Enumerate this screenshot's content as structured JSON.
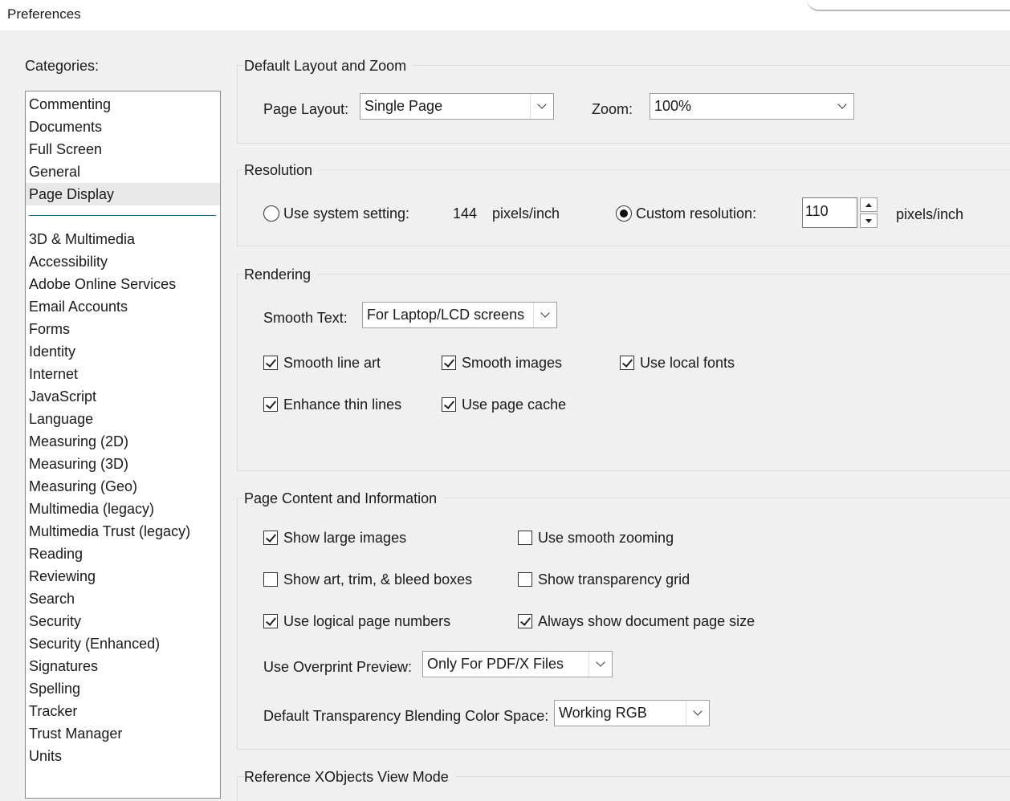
{
  "window": {
    "title": "Preferences"
  },
  "sidebar": {
    "label": "Categories:",
    "top_items": [
      "Commenting",
      "Documents",
      "Full Screen",
      "General",
      "Page Display"
    ],
    "selected": "Page Display",
    "items": [
      "3D & Multimedia",
      "Accessibility",
      "Adobe Online Services",
      "Email Accounts",
      "Forms",
      "Identity",
      "Internet",
      "JavaScript",
      "Language",
      "Measuring (2D)",
      "Measuring (3D)",
      "Measuring (Geo)",
      "Multimedia (legacy)",
      "Multimedia Trust (legacy)",
      "Reading",
      "Reviewing",
      "Search",
      "Security",
      "Security (Enhanced)",
      "Signatures",
      "Spelling",
      "Tracker",
      "Trust Manager",
      "Units"
    ]
  },
  "layout_zoom": {
    "title": "Default Layout and Zoom",
    "page_layout_label": "Page Layout:",
    "page_layout_value": "Single Page",
    "zoom_label": "Zoom:",
    "zoom_value": "100%"
  },
  "resolution": {
    "title": "Resolution",
    "system_label": "Use system setting:",
    "system_value": "144",
    "system_unit": "pixels/inch",
    "custom_label": "Custom resolution:",
    "custom_value": "110",
    "custom_unit": "pixels/inch",
    "selected": "custom"
  },
  "rendering": {
    "title": "Rendering",
    "smooth_text_label": "Smooth Text:",
    "smooth_text_value": "For Laptop/LCD screens",
    "checkboxes": [
      {
        "label": "Smooth line art",
        "checked": true
      },
      {
        "label": "Smooth images",
        "checked": true
      },
      {
        "label": "Use local fonts",
        "checked": true
      },
      {
        "label": "Enhance thin lines",
        "checked": true
      },
      {
        "label": "Use page cache",
        "checked": true
      }
    ]
  },
  "page_content": {
    "title": "Page Content and Information",
    "checkboxes": [
      {
        "label": "Show large images",
        "checked": true
      },
      {
        "label": "Use smooth zooming",
        "checked": false
      },
      {
        "label": "Show art, trim, & bleed boxes",
        "checked": false
      },
      {
        "label": "Show transparency grid",
        "checked": false
      },
      {
        "label": "Use logical page numbers",
        "checked": true
      },
      {
        "label": "Always show document page size",
        "checked": true
      }
    ],
    "overprint_label": "Use Overprint Preview:",
    "overprint_value": "Only For PDF/X Files",
    "blending_label": "Default Transparency Blending Color Space:",
    "blending_value": "Working RGB"
  },
  "xobjects": {
    "title": "Reference XObjects View Mode"
  }
}
